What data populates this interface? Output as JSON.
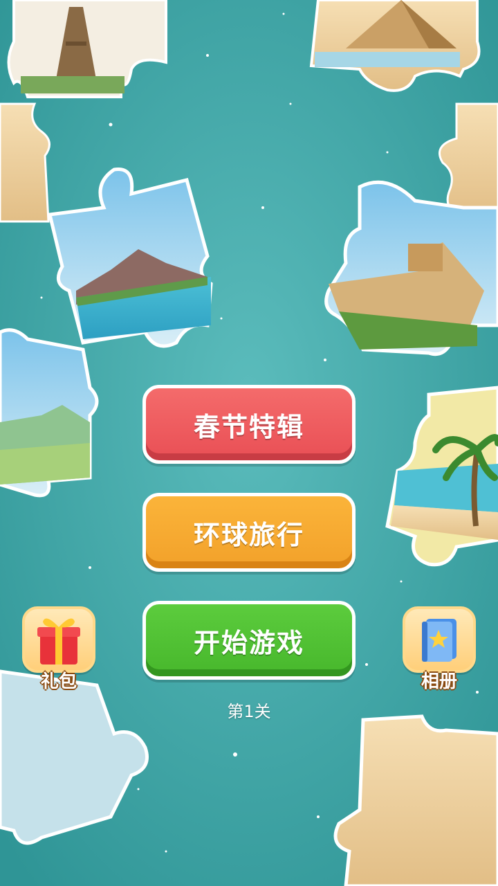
{
  "menu": {
    "spring_festival_label": "春节特辑",
    "world_tour_label": "环球旅行",
    "start_game_label": "开始游戏",
    "level_text": "第1关"
  },
  "side": {
    "gift_label": "礼包",
    "album_label": "相册"
  },
  "icons": [
    "gift-icon",
    "album-icon",
    "star-icon"
  ],
  "colors": {
    "background": "#3fa7a6",
    "red_button": "#ef5b5f",
    "orange_button": "#f5a830",
    "green_button": "#4fbf31"
  }
}
